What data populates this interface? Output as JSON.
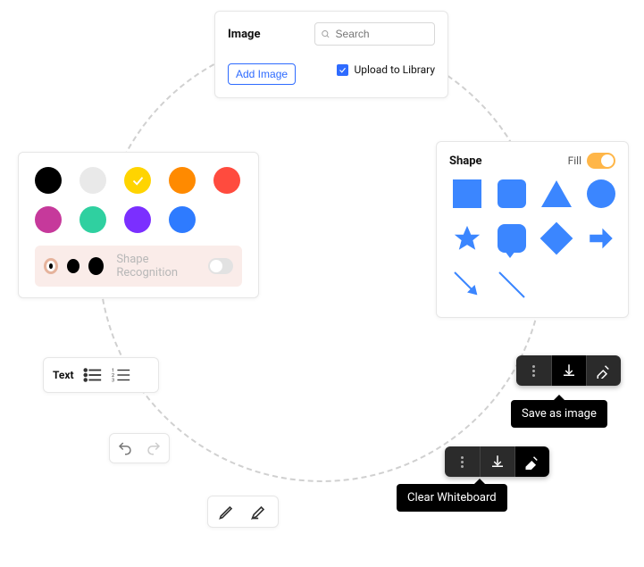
{
  "image_panel": {
    "title": "Image",
    "search_placeholder": "Search",
    "add_label": "Add Image",
    "upload_label": "Upload to Library",
    "upload_checked": true
  },
  "color_panel": {
    "swatches_row1": [
      "#000000",
      "#e9e9e9",
      "#ffd400",
      "#ff8a00",
      "#ff4b3e"
    ],
    "swatches_row2": [
      "#c6399b",
      "#2fd0a0",
      "#7b2fff",
      "#2e7bff"
    ],
    "selected_index": 2,
    "stroke_sizes": [
      "thin",
      "medium",
      "thick"
    ],
    "shape_recognition_label": "Shape Recognition",
    "shape_recognition_on": false
  },
  "shape_panel": {
    "title": "Shape",
    "fill_label": "Fill",
    "fill_on": true,
    "shapes": [
      "square",
      "rounded-square",
      "triangle",
      "circle",
      "star",
      "speech-bubble",
      "diamond",
      "arrow-right",
      "line-arrow",
      "line"
    ]
  },
  "text_panel": {
    "title": "Text",
    "options": [
      "bulleted-list",
      "numbered-list"
    ]
  },
  "undo_redo": {
    "undo": "undo",
    "redo": "redo"
  },
  "pen_panel": {
    "tools": [
      "pen",
      "highlighter"
    ]
  },
  "dark_toolbar": {
    "more": "more-options",
    "save": "save-as-image",
    "erase": "clear-whiteboard",
    "tooltip_save": "Save as image",
    "tooltip_clear": "Clear Whiteboard"
  }
}
